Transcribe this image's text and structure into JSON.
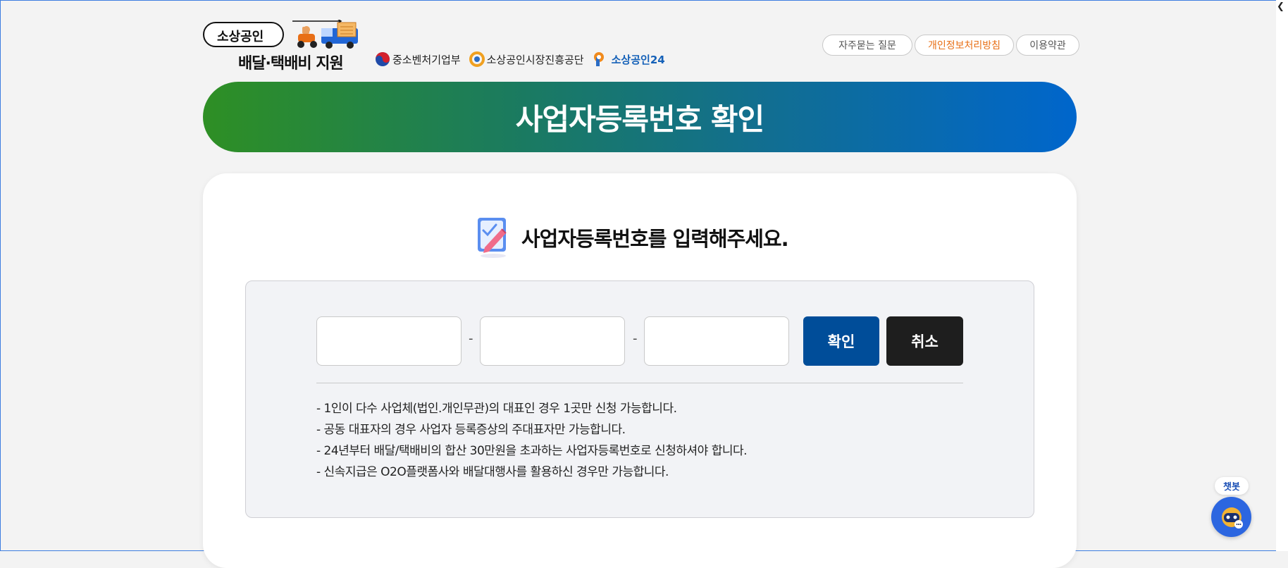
{
  "header": {
    "logo": {
      "line1": "소상공인",
      "line2": "배달·택배비 지원"
    },
    "orgs": [
      "중소벤처기업부",
      "소상공인시장진흥공단",
      "소상공인24"
    ],
    "links": [
      "자주묻는 질문",
      "개인정보처리방침",
      "이용약관"
    ]
  },
  "banner": {
    "title": "사업자등록번호 확인"
  },
  "form": {
    "heading": "사업자등록번호를 입력해주세요.",
    "inputs": [
      "",
      "",
      ""
    ],
    "separator": "-",
    "confirm_label": "확인",
    "cancel_label": "취소"
  },
  "notes": [
    "-  1인이 다수 사업체(법인.개인무관)의 대표인 경우 1곳만 신청 가능합니다.",
    "-  공동 대표자의 경우 사업자 등록증상의 주대표자만 가능합니다.",
    "-  24년부터 배달/택배비의 합산 30만원을 초과하는 사업자등록번호로 신청하셔야 합니다.",
    "-  신속지급은 O2O플랫폼사와 배달대행사를 활용하신 경우만 가능합니다."
  ],
  "chatbot": {
    "label": "챗봇"
  },
  "colors": {
    "accent_orange": "#e86f16",
    "confirm_blue": "#004d99",
    "cancel_black": "#1e1e1e",
    "banner_start": "#2e8f24",
    "banner_end": "#0066cc"
  }
}
